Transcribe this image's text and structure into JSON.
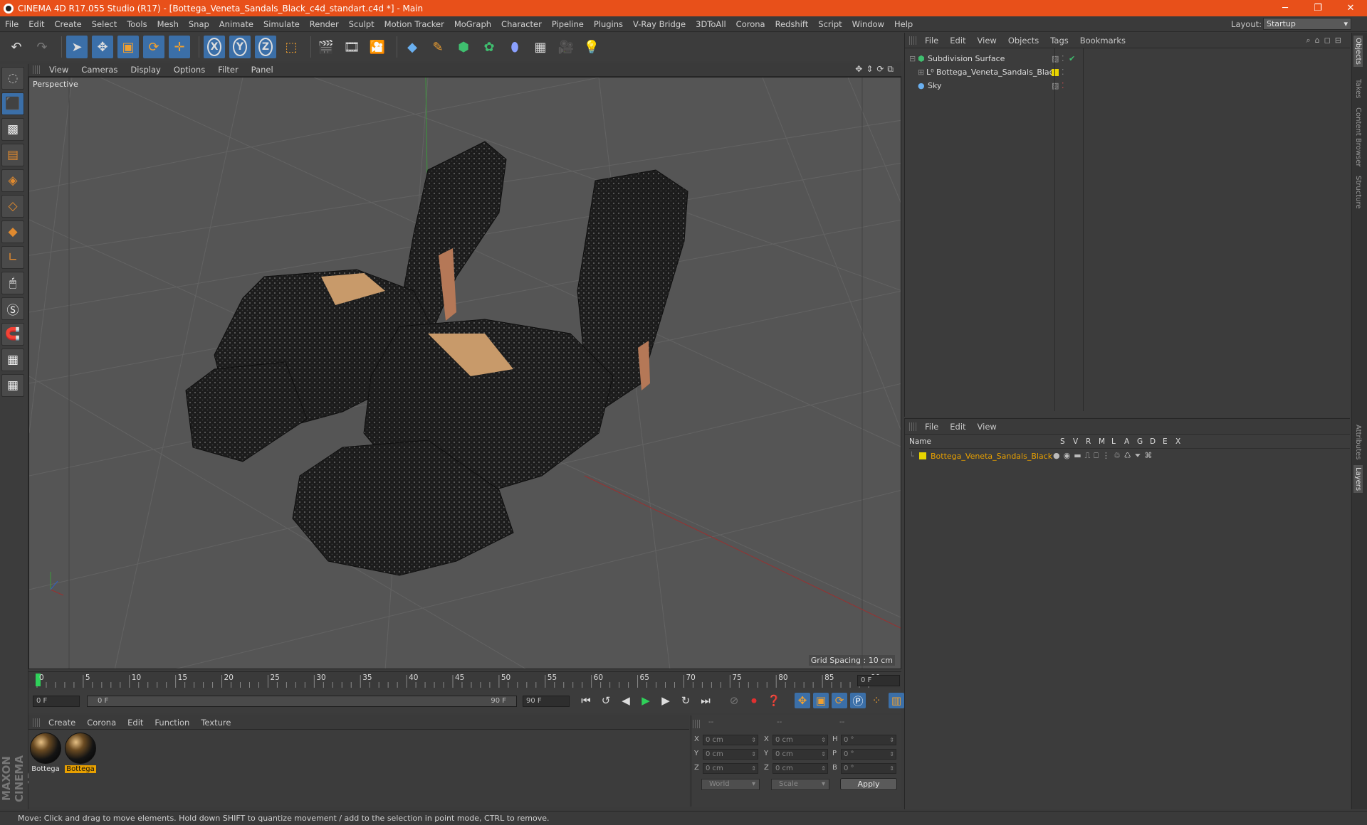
{
  "window": {
    "title": "CINEMA 4D R17.055 Studio (R17) - [Bottega_Veneta_Sandals_Black_c4d_standart.c4d *] - Main"
  },
  "menu": [
    "File",
    "Edit",
    "Create",
    "Select",
    "Tools",
    "Mesh",
    "Snap",
    "Animate",
    "Simulate",
    "Render",
    "Sculpt",
    "Motion Tracker",
    "MoGraph",
    "Character",
    "Pipeline",
    "Plugins",
    "V-Ray Bridge",
    "3DToAll",
    "Corona",
    "Redshift",
    "Script",
    "Window",
    "Help"
  ],
  "layout": {
    "label": "Layout:",
    "value": "Startup"
  },
  "viewport": {
    "menu": [
      "View",
      "Cameras",
      "Display",
      "Options",
      "Filter",
      "Panel"
    ],
    "label": "Perspective",
    "grid_spacing": "Grid Spacing : 10 cm"
  },
  "timeline": {
    "ticks": [
      "0",
      "5",
      "10",
      "15",
      "20",
      "25",
      "30",
      "35",
      "40",
      "45",
      "50",
      "55",
      "60",
      "65",
      "70",
      "75",
      "80",
      "85",
      "90"
    ],
    "current_frame": "0 F",
    "start": "0 F",
    "range_start": "0 F",
    "range_end": "90 F",
    "end": "90 F"
  },
  "materials": {
    "menu": [
      "Create",
      "Corona",
      "Edit",
      "Function",
      "Texture"
    ],
    "items": [
      {
        "label": "Bottega"
      },
      {
        "label": "Bottega"
      }
    ]
  },
  "coords": {
    "headers": [
      "--",
      "--",
      "--"
    ],
    "rows": [
      {
        "a": "X",
        "av": "0 cm",
        "b": "X",
        "bv": "0 cm",
        "c": "H",
        "cv": "0 °"
      },
      {
        "a": "Y",
        "av": "0 cm",
        "b": "Y",
        "bv": "0 cm",
        "c": "P",
        "cv": "0 °"
      },
      {
        "a": "Z",
        "av": "0 cm",
        "b": "Z",
        "bv": "0 cm",
        "c": "B",
        "cv": "0 °"
      }
    ],
    "space": "World",
    "mode": "Scale",
    "apply": "Apply"
  },
  "objects": {
    "menu": [
      "File",
      "Edit",
      "View",
      "Objects",
      "Tags",
      "Bookmarks"
    ],
    "items": [
      {
        "name": "Subdivision Surface"
      },
      {
        "name": "Bottega_Veneta_Sandals_Black"
      },
      {
        "name": "Sky"
      }
    ]
  },
  "layers": {
    "menu": [
      "File",
      "Edit",
      "View"
    ],
    "columns": {
      "name": "Name",
      "flags": [
        "S",
        "V",
        "R",
        "M",
        "L",
        "A",
        "G",
        "D",
        "E",
        "X"
      ]
    },
    "items": [
      {
        "name": "Bottega_Veneta_Sandals_Black",
        "color": "#e8d400"
      }
    ]
  },
  "right_tabs": [
    "Objects",
    "Takes",
    "Content Browser",
    "Structure",
    "Attributes",
    "Layers"
  ],
  "status": "Move: Click and drag to move elements. Hold down SHIFT to quantize movement / add to the selection in point mode, CTRL to remove.",
  "colors": {
    "titlebar": "#e8501a",
    "accent": "#3b6fa8",
    "layer_text": "#e8a000"
  }
}
